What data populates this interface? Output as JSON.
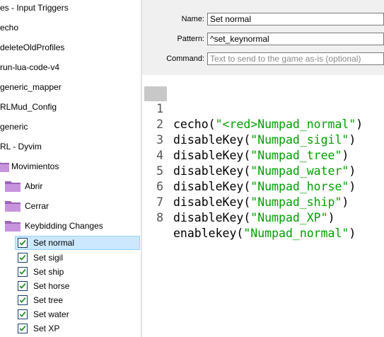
{
  "tree": {
    "rows": [
      {
        "label": "es - Input Triggers",
        "kind": "text"
      },
      {
        "label": "echo",
        "kind": "text"
      },
      {
        "label": "deleteOldProfiles",
        "kind": "text"
      },
      {
        "label": "run-lua-code-v4",
        "kind": "text"
      },
      {
        "label": "generic_mapper",
        "kind": "text"
      },
      {
        "label": "RLMud_Config",
        "kind": "text"
      },
      {
        "label": "generic",
        "kind": "text"
      },
      {
        "label": "RL - Dyvim",
        "kind": "text"
      },
      {
        "label": "Movimientos",
        "kind": "folder"
      },
      {
        "label": "Abrir",
        "kind": "folder"
      },
      {
        "label": "Cerrar",
        "kind": "folder"
      },
      {
        "label": "Keybidding Changes",
        "kind": "folder"
      },
      {
        "label": "Set normal",
        "kind": "item",
        "checked": true,
        "selected": true
      },
      {
        "label": "Set sigil",
        "kind": "item",
        "checked": true
      },
      {
        "label": "Set ship",
        "kind": "item",
        "checked": true
      },
      {
        "label": "Set horse",
        "kind": "item",
        "checked": true
      },
      {
        "label": "Set tree",
        "kind": "item",
        "checked": true
      },
      {
        "label": "Set water",
        "kind": "item",
        "checked": true
      },
      {
        "label": "Set XP",
        "kind": "item",
        "checked": true
      }
    ]
  },
  "form": {
    "name_label": "Name:",
    "name_value": "Set normal",
    "pattern_label": "Pattern:",
    "pattern_value": "^set_keynormal",
    "command_label": "Command:",
    "command_placeholder": "Text to send to the game as-is (optional)"
  },
  "editor": {
    "current_line": 1,
    "lines": [
      {
        "num": "1",
        "pre": "cecho(",
        "str": "\"<red>Numpad_normal\"",
        "post": ")"
      },
      {
        "num": "2",
        "pre": "disableKey(",
        "str": "\"Numpad_sigil\"",
        "post": ")"
      },
      {
        "num": "3",
        "pre": "disableKey(",
        "str": "\"Numpad_tree\"",
        "post": ")"
      },
      {
        "num": "4",
        "pre": "disableKey(",
        "str": "\"Numpad_water\"",
        "post": ")"
      },
      {
        "num": "5",
        "pre": "disableKey(",
        "str": "\"Numpad_horse\"",
        "post": ")"
      },
      {
        "num": "6",
        "pre": "disableKey(",
        "str": "\"Numpad_ship\"",
        "post": ")"
      },
      {
        "num": "7",
        "pre": "disableKey(",
        "str": "\"Numpad_XP\"",
        "post": ")"
      },
      {
        "num": "8",
        "pre": "enablekey(",
        "str": "\"Numpad_normal\"",
        "post": ")"
      }
    ]
  },
  "colors": {
    "string": "#00a000",
    "folder": "#b07cc6",
    "check": "#1e8f2a",
    "selection": "#cce8ff"
  },
  "icons": {
    "folder": "folder-icon",
    "check": "check-icon"
  }
}
